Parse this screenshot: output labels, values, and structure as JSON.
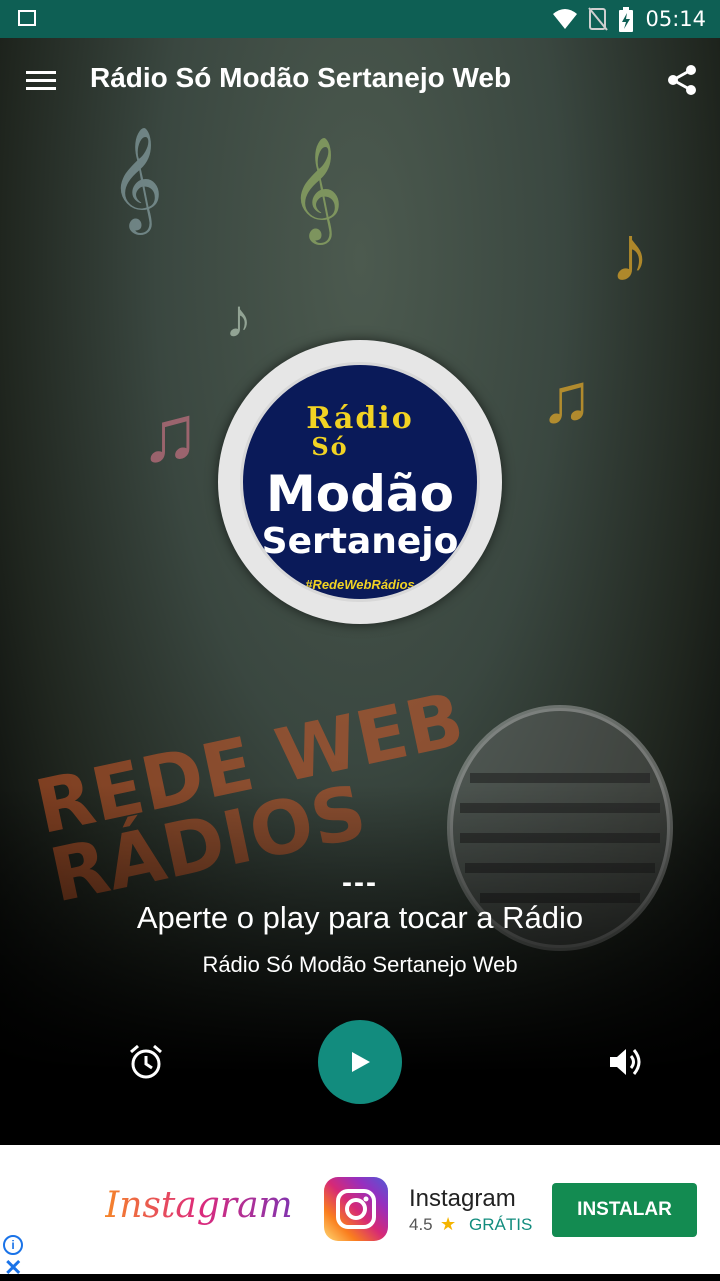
{
  "status_bar": {
    "time": "05:14",
    "icons": [
      "image-icon",
      "wifi-icon",
      "no-sim-icon",
      "battery-charging-icon"
    ]
  },
  "app_bar": {
    "title": "Rádio Só Modão Sertanejo Web",
    "menu_icon": "menu-icon",
    "share_icon": "share-icon"
  },
  "logo": {
    "line1": "Rádio",
    "line1b": "Só",
    "line2": "Modão",
    "line3": "Sertanejo",
    "tag": "#RedeWebRádios"
  },
  "background_brand": {
    "line1": "REDE WEB",
    "line2": "RÁDIOS"
  },
  "player": {
    "dash": "---",
    "title": "Aperte o play para tocar a Rádio",
    "station": "Rádio Só Modão Sertanejo Web",
    "controls": [
      "alarm-icon",
      "play-icon",
      "volume-icon"
    ]
  },
  "colors": {
    "status_bar": "#0e5f54",
    "play_button": "#128c7e",
    "install_button": "#138b51",
    "logo_blue": "#0a1a59",
    "logo_yellow": "#f2d323"
  },
  "ad": {
    "brand_text": "Instagram",
    "app_name": "Instagram",
    "rating": "4.5",
    "price": "GRÁTIS",
    "install_label": "INSTALAR",
    "info_icon": "info-icon",
    "close_icon": "close-icon"
  }
}
